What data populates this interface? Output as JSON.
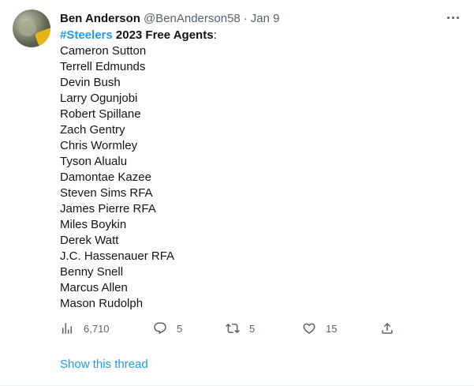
{
  "tweet": {
    "author_name": "Ben Anderson",
    "handle": "@BenAnderson58",
    "separator": "·",
    "date": "Jan 9",
    "hashtag": "#Steelers",
    "headline": " 2023 Free Agents",
    "colon": ":",
    "players": [
      "Cameron Sutton",
      "Terrell Edmunds",
      "Devin Bush",
      "Larry Ogunjobi",
      "Robert Spillane",
      "Zach Gentry",
      "Chris Wormley",
      "Tyson Alualu",
      "Damontae Kazee",
      "Steven Sims RFA",
      "James Pierre RFA",
      "Miles Boykin",
      "Derek Watt",
      "J.C. Hassenauer RFA",
      "Benny Snell",
      "Marcus Allen",
      "Mason Rudolph"
    ],
    "show_thread": "Show this thread"
  },
  "actions": {
    "views": {
      "icon": "analytics-icon",
      "count": "6,710"
    },
    "replies": {
      "icon": "reply-icon",
      "count": "5"
    },
    "retweets": {
      "icon": "retweet-icon",
      "count": "5"
    },
    "likes": {
      "icon": "heart-icon",
      "count": "15"
    },
    "share": {
      "icon": "share-icon"
    }
  },
  "colors": {
    "link": "#1d9bf0",
    "secondary_text": "#536471",
    "primary_text": "#0f1419"
  }
}
